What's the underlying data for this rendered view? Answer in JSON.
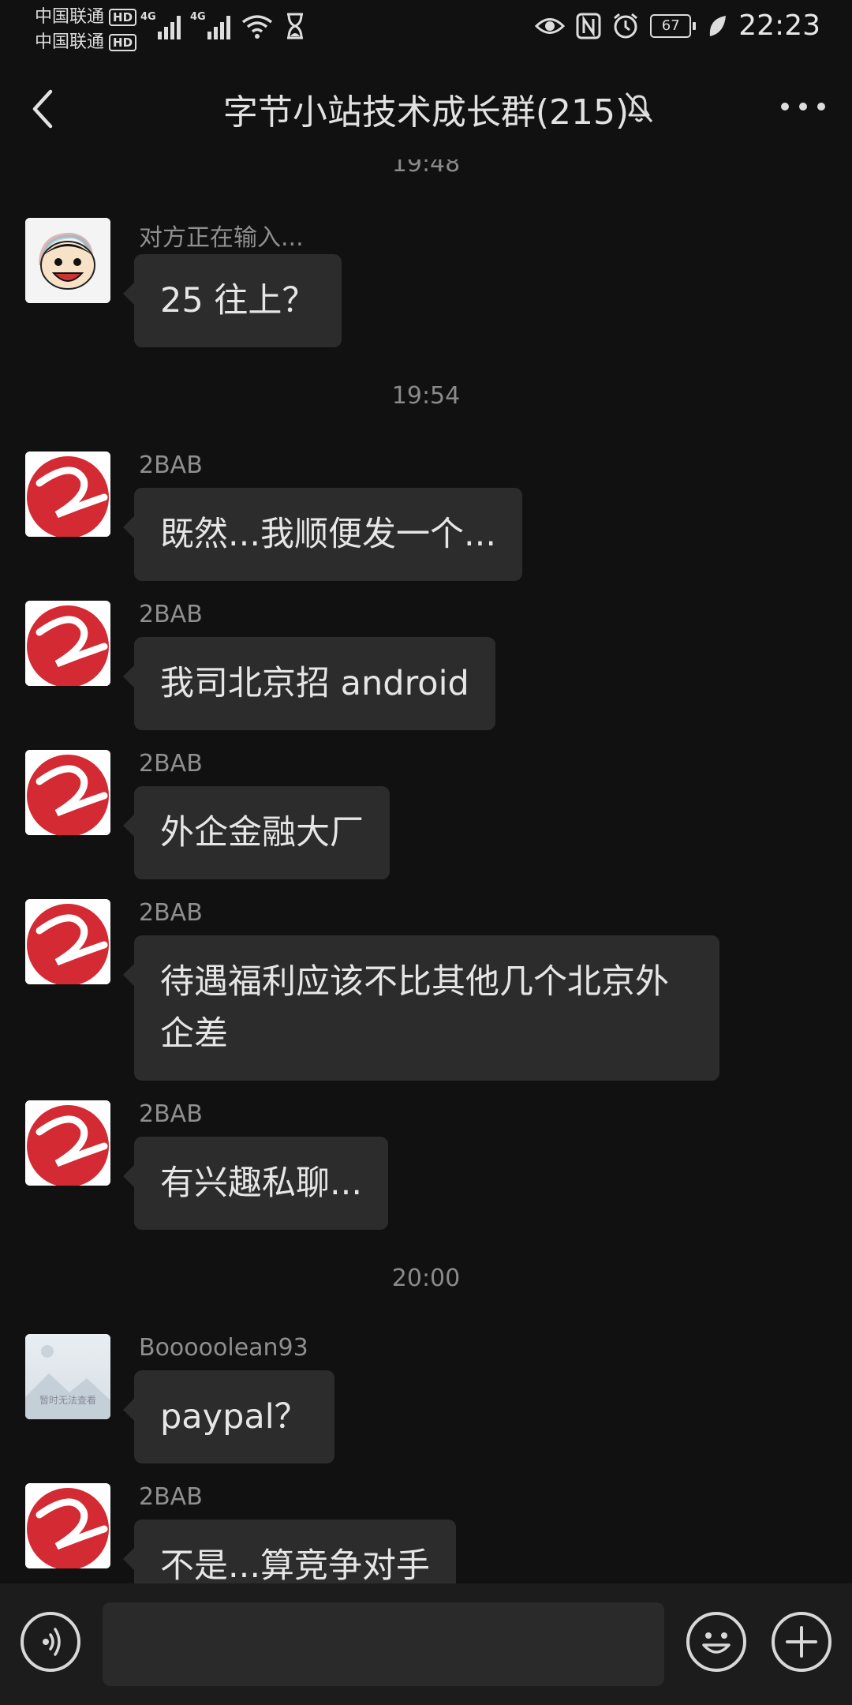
{
  "status_bar": {
    "carrier1": "中国联通",
    "carrier2": "中国联通",
    "hd_label": "HD",
    "network_tag": "4G",
    "battery": "67",
    "time": "22:23"
  },
  "header": {
    "title": "字节小站技术成长群(215)"
  },
  "messages": {
    "timestamp_top": "19:48",
    "timestamp_1": "19:54",
    "timestamp_2": "20:00",
    "items": [
      {
        "sender": "对方正在输入...",
        "text": "25 往上？"
      },
      {
        "sender": "2BAB",
        "text": "既然...我顺便发一个..."
      },
      {
        "sender": "2BAB",
        "text": "我司北京招 android"
      },
      {
        "sender": "2BAB",
        "text": "外企金融大厂"
      },
      {
        "sender": "2BAB",
        "text": "待遇福利应该不比其他几个北京外\n企差"
      },
      {
        "sender": "2BAB",
        "text": "有兴趣私聊..."
      },
      {
        "sender": "Booooolean93",
        "text": "paypal？"
      },
      {
        "sender": "2BAB",
        "text": "不是...算竞争对手"
      }
    ],
    "placeholder_avatar_text": "暂时无法查看"
  },
  "input_bar": {
    "input_value": ""
  },
  "colors": {
    "background": "#111111",
    "bubble": "#2c2c2c",
    "avatar_red": "#d42a33"
  }
}
